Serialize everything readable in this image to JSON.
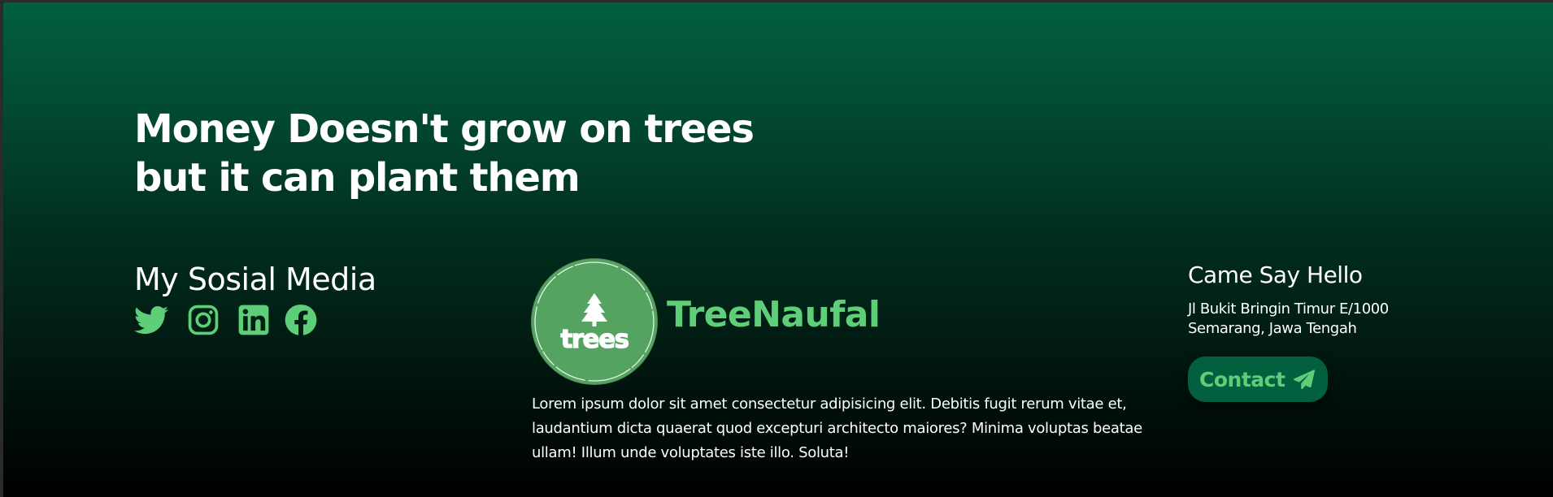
{
  "hero": {
    "line1": "Money Doesn't grow on trees",
    "line2": "but it can plant them"
  },
  "social": {
    "title": "My Sosial Media",
    "icons": [
      "twitter-icon",
      "instagram-icon",
      "linkedin-icon",
      "facebook-icon"
    ],
    "icon_color": "#5fce79"
  },
  "brand": {
    "logo_text": "trees",
    "logo_icon": "pine-tree-icon",
    "logo_color": "#55a361",
    "name": "TreeNaufal",
    "name_color": "#5fce79",
    "description": "Lorem ipsum dolor sit amet consectetur adipisicing elit. Debitis fugit rerum vitae et, laudantium dicta quaerat quod excepturi architecto maiores? Minima voluptas beatae ullam! Illum unde voluptates iste illo. Soluta!"
  },
  "contact": {
    "title": "Came Say Hello",
    "address_line1": "Jl Bukit Bringin Timur E/1000",
    "address_line2": "Semarang, Jawa Tengah",
    "button_label": "Contact",
    "button_icon": "paper-plane-icon",
    "button_bg": "#02603f"
  },
  "theme": {
    "gradient_top": "#02603f",
    "gradient_bottom": "#000000",
    "accent": "#5fce79"
  }
}
